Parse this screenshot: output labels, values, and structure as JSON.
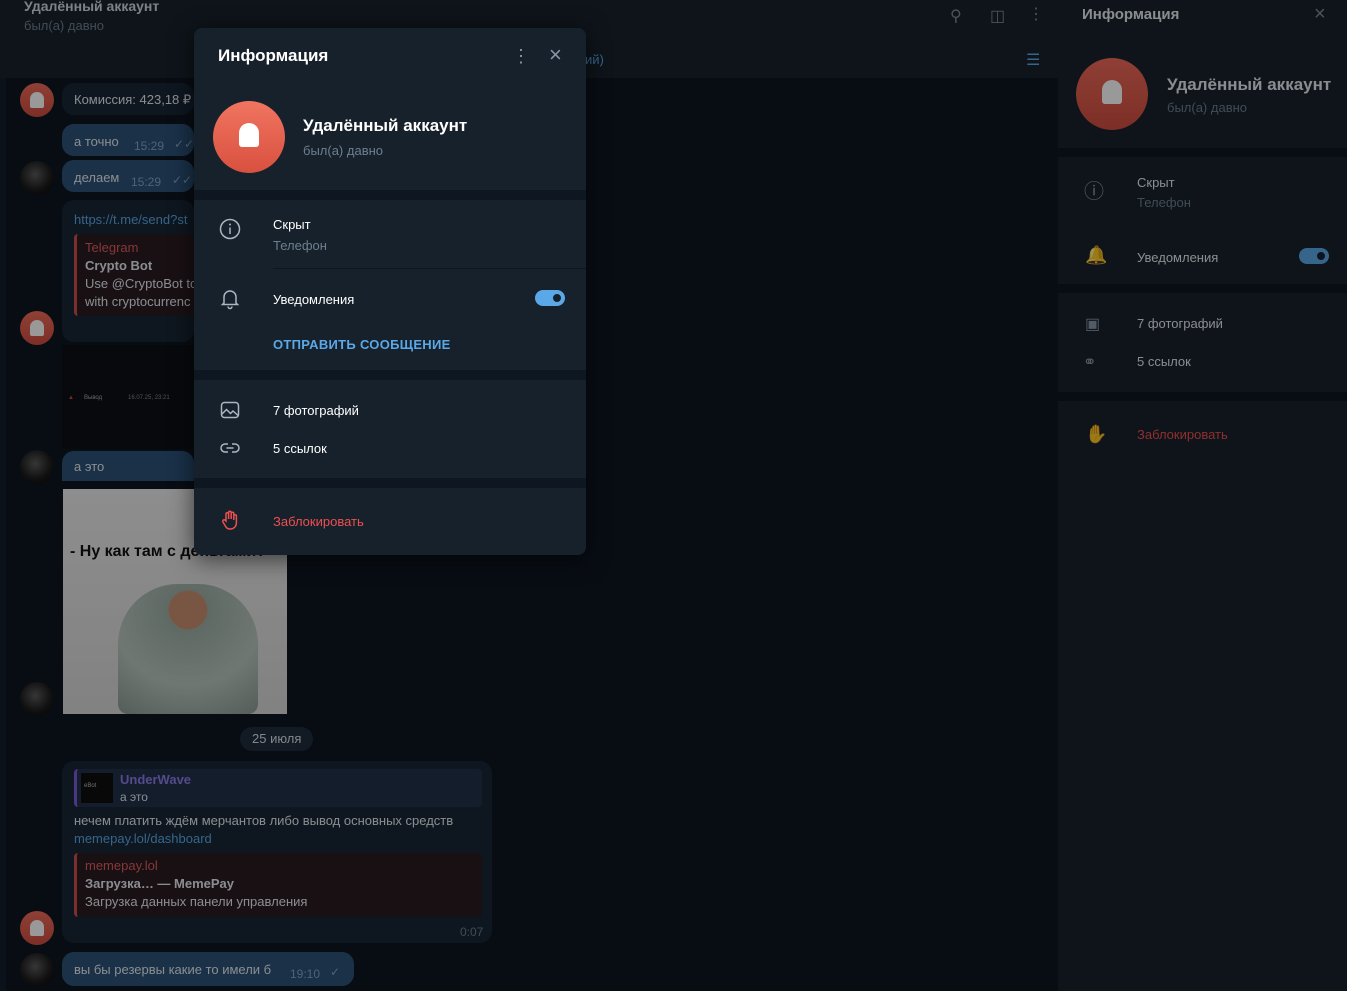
{
  "chat": {
    "title": "Удалённый аккаунт",
    "status": "был(а) давно",
    "messages": {
      "commission": "Комиссия: 423,18 ₽",
      "m1_text": "а точно",
      "m1_time": "15:29",
      "m2_text": "делаем",
      "m2_time": "15:29",
      "link_url": "https://t.me/send?st",
      "preview1_site": "Telegram",
      "preview1_title": "Crypto Bot",
      "preview1_line1": "Use @CryptoBot to",
      "preview1_line2": "with cryptocurrenc",
      "screenshot_label": "Вывод",
      "screenshot_date": "16.07.25, 23:21",
      "m3_text": "а это",
      "photo_caption": "- Ну как там с деньгами?",
      "date_divider": "25 июля",
      "reply_author": "UnderWave",
      "reply_text": "а это",
      "reply_thumb_label": "eBot",
      "m4_text": "нечем платить ждём мерчантов либо вывод основных средств",
      "m4_link": "memepay.lol/dashboard",
      "preview2_site": "memepay.lol",
      "preview2_title": "Загрузка… — MemePay",
      "preview2_desc": "Загрузка данных панели управления",
      "m4_time": "0:07",
      "m5_text": "вы бы резервы какие то имели б",
      "m5_time": "19:10",
      "filter_label": "ий)"
    }
  },
  "right_panel": {
    "title": "Информация",
    "name": "Удалённый аккаунт",
    "status": "был(а) давно",
    "phone_value": "Скрыт",
    "phone_label": "Телефон",
    "notifications_label": "Уведомления",
    "notifications_on": true,
    "photos_label": "7 фотографий",
    "links_label": "5 ссылок",
    "block_label": "Заблокировать"
  },
  "modal": {
    "title": "Информация",
    "name": "Удалённый аккаунт",
    "status": "был(а) давно",
    "phone_value": "Скрыт",
    "phone_label": "Телефон",
    "notifications_label": "Уведомления",
    "notifications_on": true,
    "send_message_label": "ОТПРАВИТЬ СООБЩЕНИЕ",
    "photos_label": "7 фотографий",
    "links_label": "5 ссылок",
    "block_label": "Заблокировать"
  },
  "colors": {
    "accent": "#5aa8e8",
    "danger": "#ee4f4f",
    "panel": "#17212b",
    "background": "#0e1621"
  }
}
